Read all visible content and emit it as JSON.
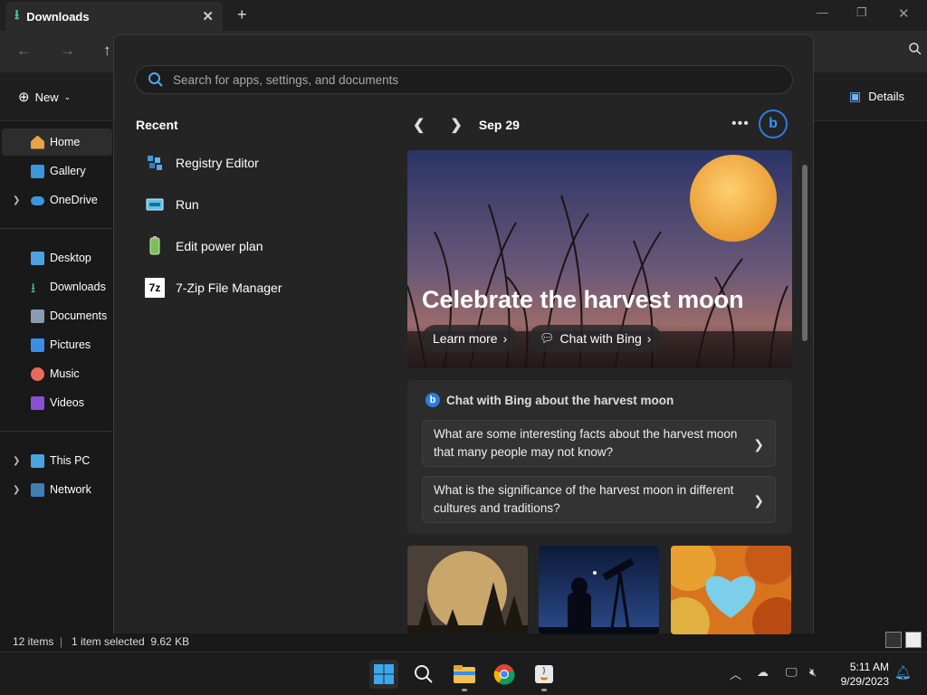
{
  "explorer": {
    "tab_title": "Downloads",
    "new_label": "New",
    "details_label": "Details",
    "sidebar": {
      "home": "Home",
      "gallery": "Gallery",
      "onedrive": "OneDrive",
      "desktop": "Desktop",
      "downloads": "Downloads",
      "documents": "Documents",
      "pictures": "Pictures",
      "music": "Music",
      "videos": "Videos",
      "this_pc": "This PC",
      "network": "Network"
    },
    "status": {
      "items": "12 items",
      "selected": "1 item selected  9.62 KB"
    }
  },
  "start": {
    "search_placeholder": "Search for apps, settings, and documents",
    "recent_title": "Recent",
    "recent": [
      {
        "label": "Registry Editor",
        "icon": "registry-icon"
      },
      {
        "label": "Run",
        "icon": "run-icon"
      },
      {
        "label": "Edit power plan",
        "icon": "power-plan-icon"
      },
      {
        "label": "7-Zip File Manager",
        "icon": "7zip-icon"
      }
    ],
    "date": "Sep 29",
    "hero": {
      "title": "Celebrate the harvest moon",
      "learn_more": "Learn more",
      "chat_with_bing": "Chat with Bing"
    },
    "chat": {
      "header": "Chat with Bing about the harvest moon",
      "questions": [
        "What are some interesting facts about the harvest moon that many people may not know?",
        "What is the significance of the harvest moon in different cultures and traditions?"
      ]
    },
    "zip_icon_text": "7z"
  },
  "taskbar": {
    "time": "5:11 AM",
    "date": "9/29/2023"
  },
  "colors": {
    "accent": "#0078d4",
    "bing": "#2b7de0",
    "background": "#191919",
    "panel": "#242424"
  }
}
